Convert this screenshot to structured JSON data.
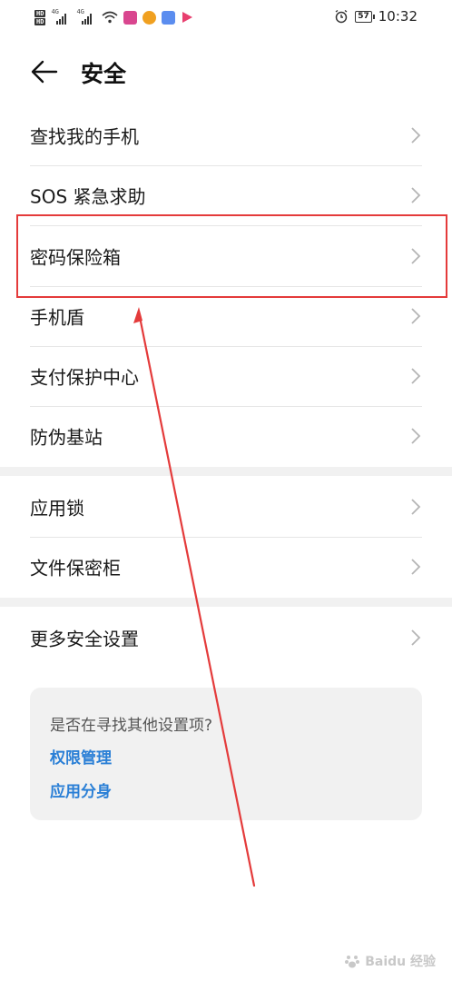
{
  "status_bar": {
    "hd1": "HD",
    "hd2": "HD",
    "net1": "4G",
    "net2": "4G",
    "battery": "57",
    "time": "10:32",
    "colors": {
      "app1": "#d9468f",
      "app2": "#f0a020",
      "app3": "#5b8def",
      "app4": "#e83f6f"
    }
  },
  "header": {
    "title": "安全",
    "back_icon": "arrow-left-icon"
  },
  "menu": {
    "items": [
      {
        "label": "查找我的手机"
      },
      {
        "label": "SOS 紧急求助"
      },
      {
        "label": "密码保险箱"
      },
      {
        "label": "手机盾"
      },
      {
        "label": "支付保护中心"
      },
      {
        "label": "防伪基站"
      },
      {
        "label": "应用锁"
      },
      {
        "label": "文件保密柜"
      },
      {
        "label": "更多安全设置"
      }
    ]
  },
  "suggestion": {
    "question": "是否在寻找其他设置项?",
    "links": [
      {
        "label": "权限管理"
      },
      {
        "label": "应用分身"
      }
    ]
  },
  "annotation": {
    "color": "#e43b3b"
  },
  "watermark": {
    "text": "Baidu 经验"
  }
}
